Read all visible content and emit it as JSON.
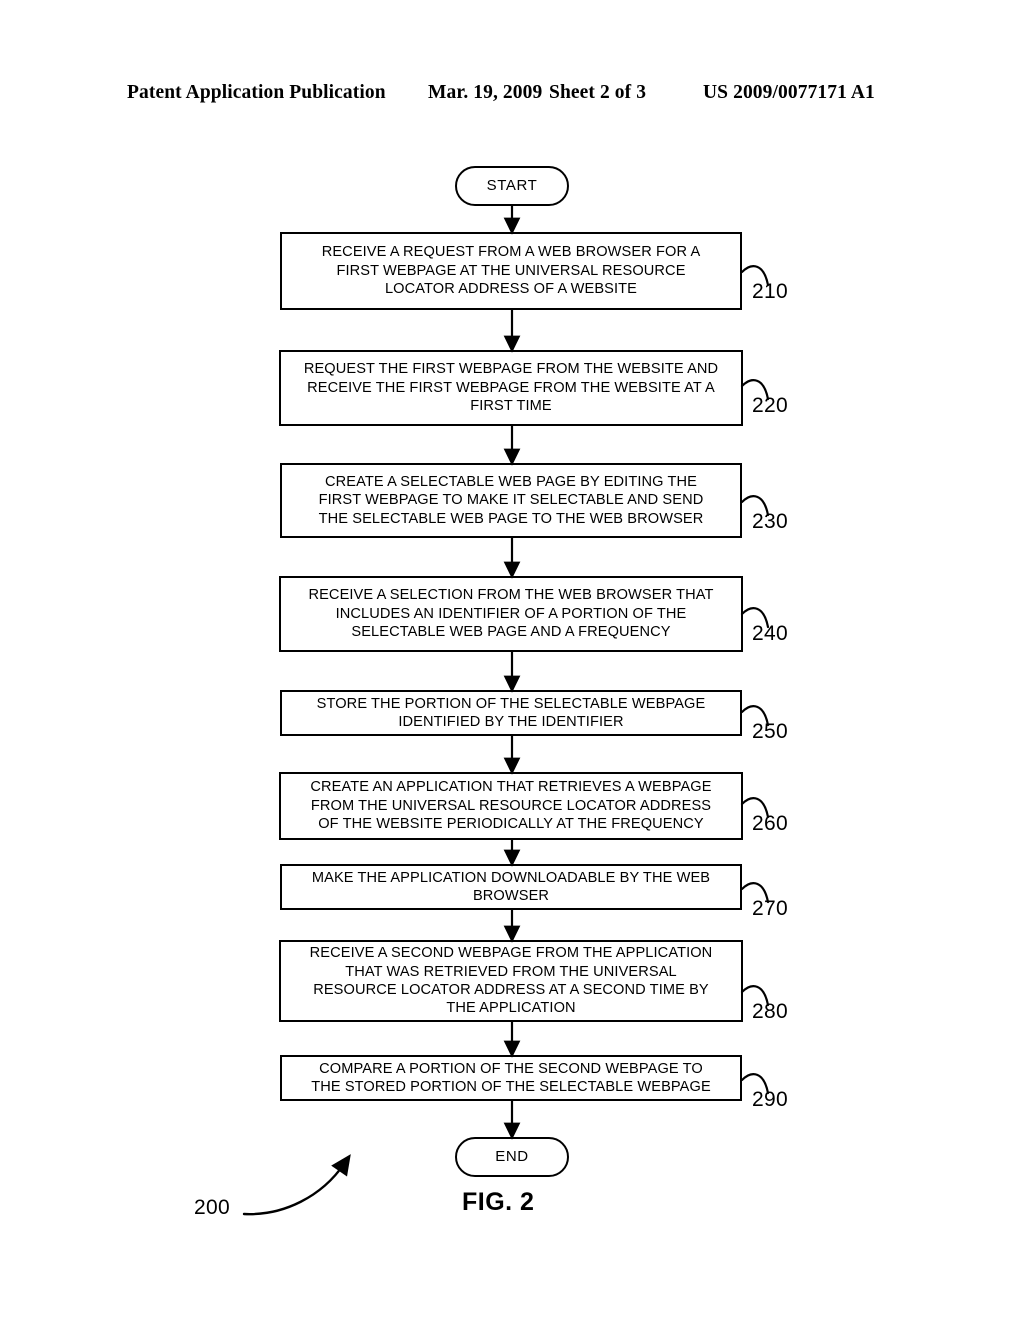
{
  "header": {
    "publication": "Patent Application Publication",
    "date": "Mar. 19, 2009",
    "sheet": "Sheet 2 of 3",
    "pub_number": "US 2009/0077171 A1"
  },
  "figure": {
    "caption": "FIG. 2",
    "diagram_numeral": "200"
  },
  "flowchart": {
    "start_label": "START",
    "end_label": "END",
    "steps": [
      {
        "ref": "210",
        "text": "RECEIVE A REQUEST FROM A WEB BROWSER FOR A\nFIRST WEBPAGE AT THE UNIVERSAL RESOURCE\nLOCATOR ADDRESS OF A WEBSITE"
      },
      {
        "ref": "220",
        "text": "REQUEST THE FIRST WEBPAGE FROM THE WEBSITE AND\nRECEIVE THE FIRST WEBPAGE FROM THE WEBSITE AT A\nFIRST TIME"
      },
      {
        "ref": "230",
        "text": "CREATE A SELECTABLE WEB PAGE BY EDITING THE\nFIRST WEBPAGE TO MAKE IT SELECTABLE AND SEND\nTHE SELECTABLE WEB PAGE TO THE WEB BROWSER"
      },
      {
        "ref": "240",
        "text": "RECEIVE A SELECTION FROM THE WEB BROWSER THAT\nINCLUDES AN IDENTIFIER OF A PORTION OF THE\nSELECTABLE WEB PAGE AND A FREQUENCY"
      },
      {
        "ref": "250",
        "text": "STORE THE PORTION OF THE SELECTABLE WEBPAGE\nIDENTIFIED BY THE IDENTIFIER"
      },
      {
        "ref": "260",
        "text": "CREATE AN APPLICATION THAT RETRIEVES A WEBPAGE\nFROM THE UNIVERSAL RESOURCE LOCATOR ADDRESS\nOF THE WEBSITE PERIODICALLY AT THE FREQUENCY"
      },
      {
        "ref": "270",
        "text": "MAKE THE APPLICATION DOWNLOADABLE BY THE WEB\nBROWSER"
      },
      {
        "ref": "280",
        "text": "RECEIVE A SECOND WEBPAGE FROM THE APPLICATION\nTHAT WAS RETRIEVED FROM THE UNIVERSAL\nRESOURCE LOCATOR ADDRESS AT A SECOND TIME BY\nTHE APPLICATION"
      },
      {
        "ref": "290",
        "text": "COMPARE A PORTION OF THE SECOND WEBPAGE TO\nTHE STORED PORTION OF THE SELECTABLE WEBPAGE"
      }
    ]
  },
  "colors": {
    "ink": "#000000",
    "paper": "#ffffff"
  }
}
